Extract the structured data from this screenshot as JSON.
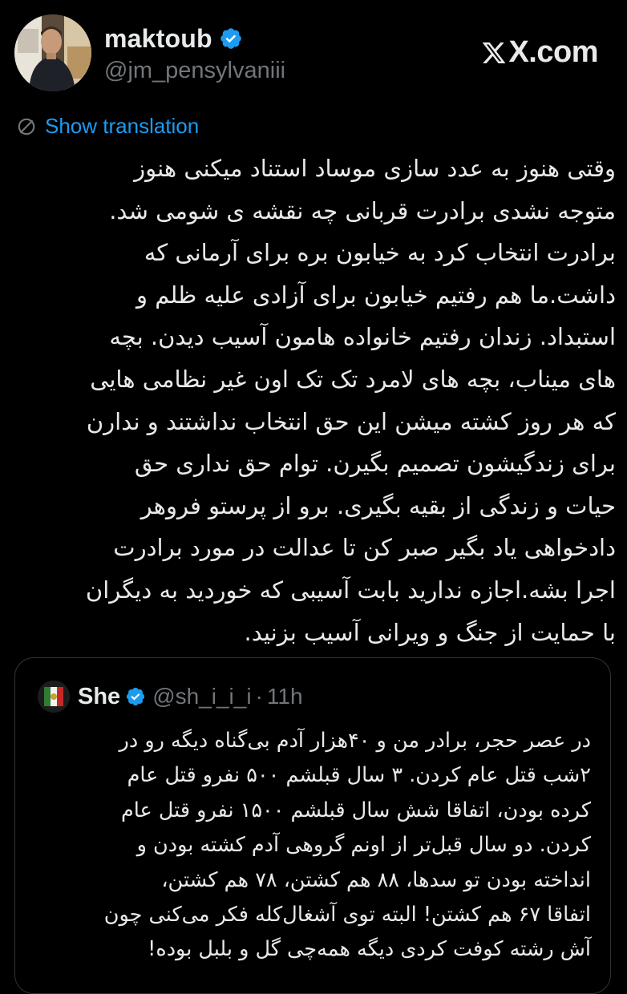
{
  "author": {
    "display_name": "maktoub",
    "handle": "@jm_pensylvaniii",
    "verified": true
  },
  "brand": {
    "site": "X.com"
  },
  "translation": {
    "label": "Show translation"
  },
  "tweet": {
    "lines": [
      "وقتی هنوز به عدد سازی موساد استناد میکنی هنوز",
      "متوجه نشدی برادرت قربانی چه نقشه ی شومی شد.",
      "برادرت انتخاب کرد به خیابون بره برای آرمانی که",
      "داشت.ما هم رفتیم خیابون برای آزادی علیه ظلم و",
      "استبداد. زندان رفتیم خانواده هامون آسیب دیدن. بچه",
      "های میناب، بچه های لامرد تک تک اون غیر نظامی هایی",
      "که هر روز کشته میشن این حق انتخاب نداشتند و ندارن",
      "برای زندگیشون تصمیم بگیرن. توام حق نداری حق",
      "حیات و زندگی از بقیه بگیری. برو از پرستو فروهر",
      "دادخواهی یاد بگیر صبر کن تا عدالت در مورد برادرت",
      "اجرا بشه.اجازه ندارید بابت آسیبی که خوردید به دیگران",
      "با حمایت از جنگ و ویرانی آسیب بزنید."
    ]
  },
  "quoted": {
    "display_name": "She",
    "handle": "@sh_i_i_i",
    "dot": "·",
    "time": "11h",
    "verified": true,
    "lines": [
      "در عصر حجر، برادر من و ۴۰هزار آدم بی‌گناه دیگه رو در",
      "۲شب قتل عام کردن. ۳ سال قبلشم ۵۰۰ نفرو قتل عام",
      "کرده بودن، اتفاقا شش سال قبلشم ۱۵۰۰ نفرو قتل عام",
      "کردن. دو سال قبل‌تر از اونم گروهی آدم کشته بودن و",
      "انداخته بودن تو سدها، ۸۸ هم کشتن، ۷۸ هم کشتن،",
      "اتفاقا ۶۷ هم کشتن! البته توی آشغال‌کله فکر می‌کنی چون",
      "آش رشته کوفت کردی دیگه همه‌چی گل و بلبل بوده!"
    ]
  },
  "colors": {
    "background": "#000000",
    "text": "#e7e9ea",
    "secondary_text": "#71767b",
    "link": "#1d9bf0",
    "verified_badge": "#1d9bf0",
    "border": "#2f3336"
  }
}
